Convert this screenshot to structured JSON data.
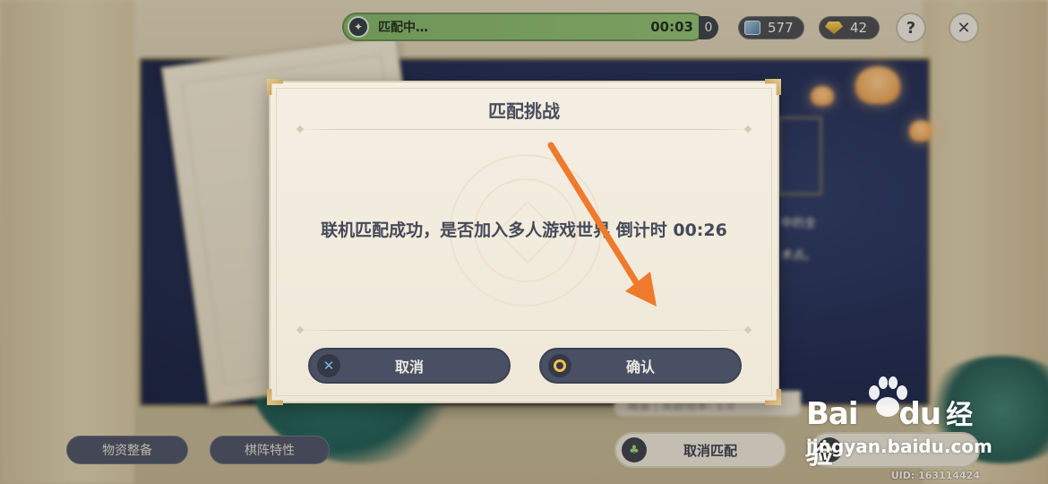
{
  "hud": {
    "match_status_label": "匹配中…",
    "match_timer": "00:03",
    "stub_value": "0",
    "card_count": "577",
    "gem_count": "42",
    "help_icon": "question-icon",
    "close_icon": "close-icon"
  },
  "background": {
    "side_text_1": "中的全",
    "side_text_2": "术点。",
    "difficulty_text": "难度 | 奖励倍率: 1.0"
  },
  "bottom": {
    "tab_supplies": "物资整备",
    "tab_formation": "棋阵特性",
    "cancel_match_label": "取消匹配",
    "uid_text": "UID: 163114424"
  },
  "modal": {
    "title": "匹配挑战",
    "message": "联机匹配成功，是否加入多人游戏世界 倒计时 00:26",
    "cancel_label": "取消",
    "confirm_label": "确认"
  },
  "watermark": {
    "logo_left": "Bai",
    "logo_mid": "du",
    "logo_right": "经验",
    "url": "jingyan.baidu.com"
  },
  "colors": {
    "annotation_arrow": "#f07a2c",
    "match_bar": "#8dbb70",
    "modal_button": "#4a5064",
    "confirm_glyph": "#f0c24a",
    "cancel_glyph": "#7fb6e6"
  }
}
